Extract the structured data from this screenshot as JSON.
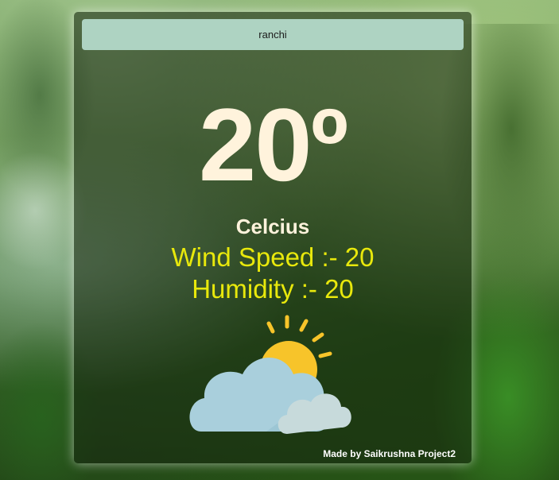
{
  "search": {
    "value": "ranchi"
  },
  "weather": {
    "temperature": "20º",
    "unit_label": "Celcius",
    "wind_speed": "Wind Speed :- 20",
    "humidity": "Humidity :- 20",
    "icon": "partly-cloudy-icon"
  },
  "footer": {
    "credit": "Made by Saikrushna Project2"
  },
  "colors": {
    "search_bg": "#aed3c2",
    "temperature_text": "#fff3dc",
    "stats_text": "#e8e80c",
    "sun": "#f7c42a",
    "cloud_front": "#a9cfdc",
    "cloud_back": "#c7dadb"
  }
}
